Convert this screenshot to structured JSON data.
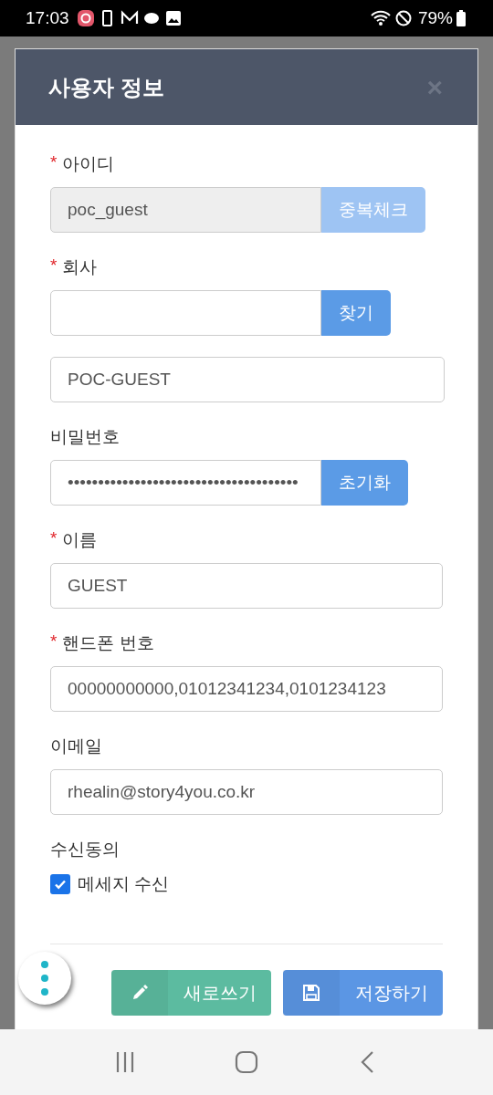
{
  "status_bar": {
    "time": "17:03",
    "battery": "79%"
  },
  "dialog": {
    "title": "사용자 정보",
    "close": "×"
  },
  "fields": [
    {
      "kind": "input_button",
      "required_mark": "*",
      "label": "아이디",
      "value": "poc_guest",
      "disabled": true,
      "button": {
        "label": "중복체크",
        "disabled": true
      }
    },
    {
      "kind": "input_button",
      "required_mark": "*",
      "label": "회사",
      "disabled": false,
      "button": {
        "label": "찾기",
        "disabled": false
      },
      "extra_value": "POC-GUEST"
    },
    {
      "kind": "input_button",
      "label": "비밀번호",
      "value": "••••••••••••••••••••••••••••••••••••••",
      "disabled": false,
      "button": {
        "label": "초기화",
        "disabled": false
      }
    },
    {
      "kind": "input",
      "required_mark": "*",
      "label": "이름",
      "value": "GUEST",
      "disabled": false
    },
    {
      "kind": "input",
      "required_mark": "*",
      "label": "핸드폰 번호",
      "value": "00000000000,01012341234,0101234123",
      "disabled": false
    },
    {
      "kind": "input",
      "label": "이메일",
      "value": "rhealin@story4you.co.kr",
      "disabled": false
    },
    {
      "kind": "checkbox",
      "label": "수신동의",
      "option": "메세지 수신",
      "checked": true
    }
  ],
  "footer_buttons": [
    {
      "kind": "reset",
      "label": "새로쓰기"
    },
    {
      "kind": "save",
      "label": "저장하기"
    }
  ]
}
